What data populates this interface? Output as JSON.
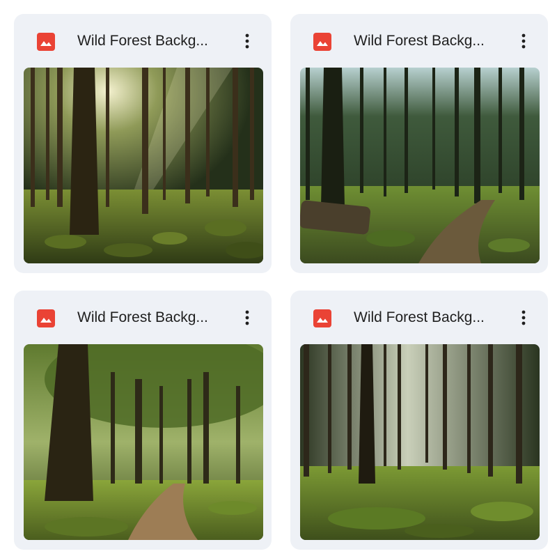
{
  "files": [
    {
      "title": "Wild Forest Backg...",
      "file_type_icon": "image-file-icon",
      "menu_icon": "more-vert-icon",
      "preview": "forest-photo-thumbnail"
    },
    {
      "title": "Wild Forest Backg...",
      "file_type_icon": "image-file-icon",
      "menu_icon": "more-vert-icon",
      "preview": "forest-photo-thumbnail"
    },
    {
      "title": "Wild Forest Backg...",
      "file_type_icon": "image-file-icon",
      "menu_icon": "more-vert-icon",
      "preview": "forest-photo-thumbnail"
    },
    {
      "title": "Wild Forest Backg...",
      "file_type_icon": "image-file-icon",
      "menu_icon": "more-vert-icon",
      "preview": "forest-photo-thumbnail"
    }
  ],
  "colors": {
    "card_background": "#eef1f6",
    "icon_red": "#ea4335",
    "title_text": "#1f1f1f"
  }
}
